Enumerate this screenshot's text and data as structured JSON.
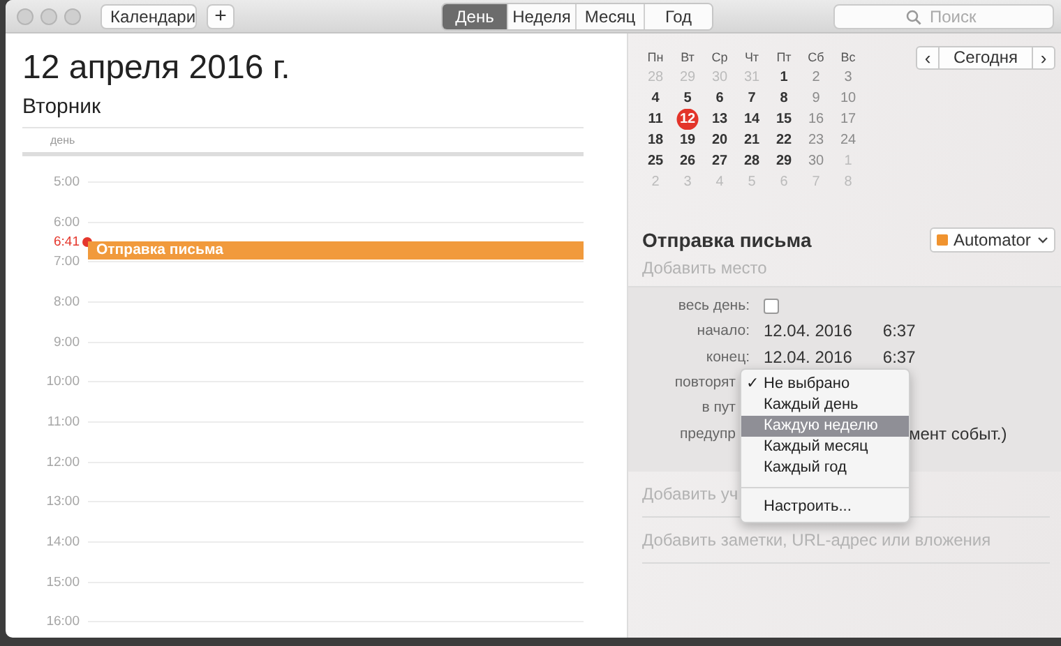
{
  "toolbar": {
    "calendars_button": "Календари",
    "add_button": "+",
    "views": [
      {
        "label": "День",
        "selected": true
      },
      {
        "label": "Неделя",
        "selected": false
      },
      {
        "label": "Месяц",
        "selected": false
      },
      {
        "label": "Год",
        "selected": false
      }
    ],
    "search": {
      "placeholder": "Поиск"
    }
  },
  "day_view": {
    "date_day": "12 апреля",
    "date_year": "2016 г.",
    "weekday": "Вторник",
    "allday_label": "день",
    "hours": [
      "5:00",
      "6:00",
      "7:00",
      "8:00",
      "9:00",
      "10:00",
      "11:00",
      "12:00",
      "13:00",
      "14:00",
      "15:00",
      "16:00"
    ],
    "now_time": "6:41",
    "event": "Отправка письма"
  },
  "mini_calendar": {
    "weekdays": [
      "Пн",
      "Вт",
      "Ср",
      "Чт",
      "Пт",
      "Сб",
      "Вс"
    ],
    "weeks": [
      [
        {
          "d": "28",
          "kind": "other"
        },
        {
          "d": "29",
          "kind": "other"
        },
        {
          "d": "30",
          "kind": "other"
        },
        {
          "d": "31",
          "kind": "other"
        },
        {
          "d": "1",
          "kind": "day"
        },
        {
          "d": "2",
          "kind": "weekend"
        },
        {
          "d": "3",
          "kind": "weekend"
        }
      ],
      [
        {
          "d": "4",
          "kind": "day"
        },
        {
          "d": "5",
          "kind": "day"
        },
        {
          "d": "6",
          "kind": "day"
        },
        {
          "d": "7",
          "kind": "day"
        },
        {
          "d": "8",
          "kind": "day"
        },
        {
          "d": "9",
          "kind": "weekend"
        },
        {
          "d": "10",
          "kind": "weekend"
        }
      ],
      [
        {
          "d": "11",
          "kind": "day"
        },
        {
          "d": "12",
          "kind": "today"
        },
        {
          "d": "13",
          "kind": "day"
        },
        {
          "d": "14",
          "kind": "day"
        },
        {
          "d": "15",
          "kind": "day"
        },
        {
          "d": "16",
          "kind": "weekend"
        },
        {
          "d": "17",
          "kind": "weekend"
        }
      ],
      [
        {
          "d": "18",
          "kind": "day"
        },
        {
          "d": "19",
          "kind": "day"
        },
        {
          "d": "20",
          "kind": "day"
        },
        {
          "d": "21",
          "kind": "day"
        },
        {
          "d": "22",
          "kind": "day"
        },
        {
          "d": "23",
          "kind": "weekend"
        },
        {
          "d": "24",
          "kind": "weekend"
        }
      ],
      [
        {
          "d": "25",
          "kind": "day"
        },
        {
          "d": "26",
          "kind": "day"
        },
        {
          "d": "27",
          "kind": "day"
        },
        {
          "d": "28",
          "kind": "day"
        },
        {
          "d": "29",
          "kind": "day"
        },
        {
          "d": "30",
          "kind": "weekend"
        },
        {
          "d": "1",
          "kind": "other"
        }
      ],
      [
        {
          "d": "2",
          "kind": "other"
        },
        {
          "d": "3",
          "kind": "other"
        },
        {
          "d": "4",
          "kind": "other"
        },
        {
          "d": "5",
          "kind": "other"
        },
        {
          "d": "6",
          "kind": "other"
        },
        {
          "d": "7",
          "kind": "other"
        },
        {
          "d": "8",
          "kind": "other"
        }
      ]
    ],
    "prev": "‹",
    "today_button": "Сегодня",
    "next": "›"
  },
  "event_details": {
    "title": "Отправка письма",
    "calendar": {
      "name": "Automator",
      "color": "#f0932f"
    },
    "location_placeholder": "Добавить место",
    "fields": [
      {
        "label": "весь день:",
        "kind": "checkbox",
        "checked": false
      },
      {
        "label": "начало:",
        "kind": "datetime",
        "date": "12.04. 2016",
        "time": "6:37"
      },
      {
        "label": "конец:",
        "kind": "datetime",
        "date": "12.04. 2016",
        "time": "6:37"
      },
      {
        "label": "повторят",
        "kind": "covered"
      },
      {
        "label": "в пут",
        "kind": "covered"
      },
      {
        "label": "предупр",
        "kind": "tail",
        "value": "мент событ.)"
      }
    ],
    "invitees_placeholder": "Добавить уч",
    "notes_placeholder": "Добавить заметки, URL-адрес или вложения"
  },
  "repeat_menu": {
    "items": [
      {
        "label": "Не выбрано",
        "checked": true,
        "selected": false
      },
      {
        "label": "Каждый день",
        "checked": false,
        "selected": false
      },
      {
        "label": "Каждую неделю",
        "checked": false,
        "selected": true
      },
      {
        "label": "Каждый месяц",
        "checked": false,
        "selected": false
      },
      {
        "label": "Каждый год",
        "checked": false,
        "selected": false
      }
    ],
    "check_mark": "✓",
    "custom": "Настроить..."
  }
}
